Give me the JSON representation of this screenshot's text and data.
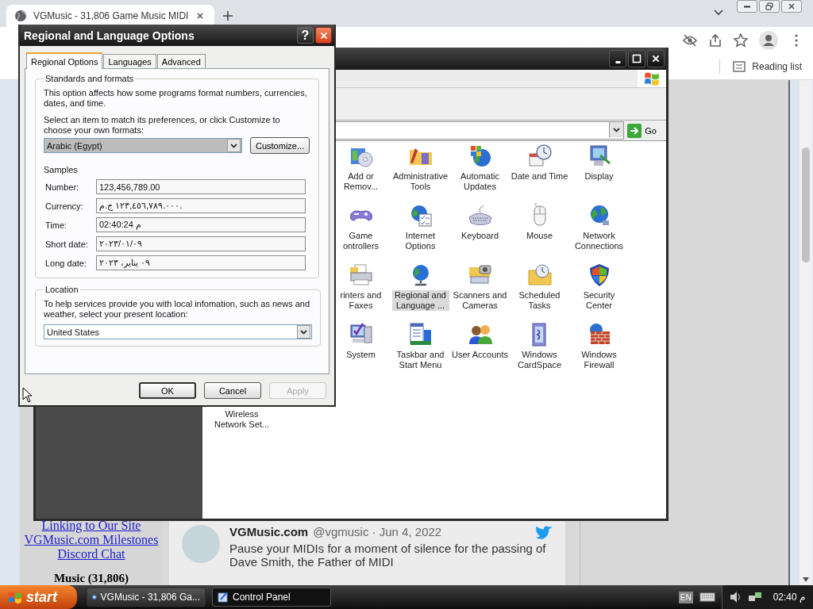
{
  "browser": {
    "tab_title": "VGMusic - 31,806 Game Music MIDI",
    "reading_list": "Reading list"
  },
  "page": {
    "links": [
      "Linking to Our Site",
      "VGMusic.com Milestones",
      "Discord Chat"
    ],
    "music_heading": "Music (31,806)",
    "tweet": {
      "name": "VGMusic.com",
      "meta": "@vgmusic · Jun 4, 2022",
      "text": "Pause your MIDIs for a moment of silence for the passing of Dave Smith, the Father of MIDI"
    }
  },
  "control_panel": {
    "go_button": "Go",
    "items": [
      {
        "label": "Add or Remov...",
        "selected": false
      },
      {
        "label": "Administrative Tools",
        "selected": false
      },
      {
        "label": "Automatic Updates",
        "selected": false
      },
      {
        "label": "Date and Time",
        "selected": false
      },
      {
        "label": "Display",
        "selected": false
      },
      {
        "label": "Game ontrollers",
        "selected": false
      },
      {
        "label": "Internet Options",
        "selected": false
      },
      {
        "label": "Keyboard",
        "selected": false
      },
      {
        "label": "Mouse",
        "selected": false
      },
      {
        "label": "Network Connections",
        "selected": false
      },
      {
        "label": "rinters and Faxes",
        "selected": false
      },
      {
        "label": "Regional and Language ...",
        "selected": true
      },
      {
        "label": "Scanners and Cameras",
        "selected": false
      },
      {
        "label": "Scheduled Tasks",
        "selected": false
      },
      {
        "label": "Security Center",
        "selected": false
      },
      {
        "label": "System",
        "selected": false
      },
      {
        "label": "Taskbar and Start Menu",
        "selected": false
      },
      {
        "label": "User Accounts",
        "selected": false
      },
      {
        "label": "Windows CardSpace",
        "selected": false
      },
      {
        "label": "Windows Firewall",
        "selected": false
      }
    ],
    "partial_item_label": "Wireless Network Set..."
  },
  "dialog": {
    "title": "Regional and Language Options",
    "help": "?",
    "tabs": [
      {
        "label": "Regional Options",
        "selected": true
      },
      {
        "label": "Languages",
        "selected": false
      },
      {
        "label": "Advanced",
        "selected": false
      }
    ],
    "standards": {
      "legend": "Standards and formats",
      "description": "This option affects how some programs format numbers, currencies, dates, and time.",
      "instruction": "Select an item to match its preferences, or click Customize to choose your own formats:",
      "format": "Arabic (Egypt)",
      "customize": "Customize...",
      "samples_heading": "Samples",
      "samples": [
        {
          "label": "Number:",
          "value": "123,456,789.00"
        },
        {
          "label": "Currency:",
          "value": "١٢٣,٤٥٦,٧٨٩.٠٠٠ ج.م."
        },
        {
          "label": "Time:",
          "value": "02:40:24 م"
        },
        {
          "label": "Short date:",
          "value": "٢٠٢٣/٠١/٠٩"
        },
        {
          "label": "Long date:",
          "value": "٠٩ يناير، ٢٠٢٣"
        }
      ]
    },
    "location": {
      "legend": "Location",
      "description": "To help services provide you with local infomation, such as news and weather, select your present location:",
      "value": "United States"
    },
    "buttons": [
      {
        "label": "OK",
        "default": true,
        "disabled": false
      },
      {
        "label": "Cancel",
        "default": false,
        "disabled": false
      },
      {
        "label": "Apply",
        "default": false,
        "disabled": true
      }
    ]
  },
  "taskbar": {
    "start": "start",
    "tasks": [
      {
        "label": "VGMusic - 31,806 Ga...",
        "selected": false
      },
      {
        "label": "Control Panel",
        "selected": true
      }
    ],
    "language": "EN",
    "clock": "02:40 م"
  }
}
